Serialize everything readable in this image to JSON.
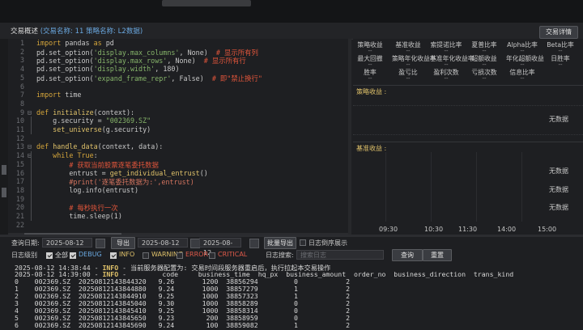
{
  "header": {
    "title": "交易概述",
    "meta": "(交易名称: 11  策略名称: L2数据)",
    "detail_button": "交易详情"
  },
  "editor": {
    "lines": [
      {
        "n": "1",
        "fold": "",
        "tokens": [
          {
            "c": "kw",
            "t": "import"
          },
          {
            "c": "",
            "t": " pandas "
          },
          {
            "c": "kw",
            "t": "as"
          },
          {
            "c": "",
            "t": " pd"
          }
        ]
      },
      {
        "n": "2",
        "fold": "",
        "tokens": [
          {
            "c": "",
            "t": "pd.set_option("
          },
          {
            "c": "st",
            "t": "'display.max_columns'"
          },
          {
            "c": "",
            "t": ", None)  "
          },
          {
            "c": "cm",
            "t": "# 显示所有列"
          }
        ]
      },
      {
        "n": "3",
        "fold": "",
        "tokens": [
          {
            "c": "",
            "t": "pd.set_option("
          },
          {
            "c": "st",
            "t": "'display.max_rows'"
          },
          {
            "c": "",
            "t": ", None)  "
          },
          {
            "c": "cm",
            "t": "# 显示所有行"
          }
        ]
      },
      {
        "n": "4",
        "fold": "",
        "tokens": [
          {
            "c": "",
            "t": "pd.set_option("
          },
          {
            "c": "st",
            "t": "'display.width'"
          },
          {
            "c": "",
            "t": ", 180)"
          }
        ]
      },
      {
        "n": "5",
        "fold": "",
        "tokens": [
          {
            "c": "",
            "t": "pd.set_option("
          },
          {
            "c": "st",
            "t": "'expand_frame_repr'"
          },
          {
            "c": "",
            "t": ", False)  "
          },
          {
            "c": "cm",
            "t": "# 即\"禁止换行\""
          }
        ]
      },
      {
        "n": "6",
        "fold": "",
        "tokens": []
      },
      {
        "n": "7",
        "fold": "",
        "tokens": [
          {
            "c": "kw",
            "t": "import"
          },
          {
            "c": "",
            "t": " time"
          }
        ]
      },
      {
        "n": "8",
        "fold": "",
        "tokens": []
      },
      {
        "n": "9",
        "fold": "⊟",
        "tokens": [
          {
            "c": "kw",
            "t": "def"
          },
          {
            "c": "",
            "t": " "
          },
          {
            "c": "fn",
            "t": "initialize"
          },
          {
            "c": "",
            "t": "(context):"
          }
        ]
      },
      {
        "n": "10",
        "fold": "",
        "tokens": [
          {
            "c": "",
            "t": "    g.security = "
          },
          {
            "c": "st",
            "t": "\"002369.SZ\""
          }
        ]
      },
      {
        "n": "11",
        "fold": "",
        "tokens": [
          {
            "c": "",
            "t": "    "
          },
          {
            "c": "fn",
            "t": "set_universe"
          },
          {
            "c": "",
            "t": "(g.security)"
          }
        ]
      },
      {
        "n": "12",
        "fold": "",
        "tokens": []
      },
      {
        "n": "13",
        "fold": "⊟",
        "tokens": [
          {
            "c": "kw",
            "t": "def"
          },
          {
            "c": "",
            "t": " "
          },
          {
            "c": "fn",
            "t": "handle_data"
          },
          {
            "c": "",
            "t": "(context, data):"
          }
        ]
      },
      {
        "n": "14",
        "fold": "⊟",
        "tokens": [
          {
            "c": "",
            "t": "    "
          },
          {
            "c": "kw",
            "t": "while"
          },
          {
            "c": "",
            "t": " "
          },
          {
            "c": "kw",
            "t": "True"
          },
          {
            "c": "",
            "t": ":"
          }
        ]
      },
      {
        "n": "15",
        "fold": "",
        "tokens": [
          {
            "c": "",
            "t": "        "
          },
          {
            "c": "cm",
            "t": "# 获取当前股票逐笔委托数据"
          }
        ]
      },
      {
        "n": "16",
        "fold": "",
        "tokens": [
          {
            "c": "",
            "t": "        entrust = "
          },
          {
            "c": "fn",
            "t": "get_individual_entrust"
          },
          {
            "c": "",
            "t": "()"
          }
        ]
      },
      {
        "n": "17",
        "fold": "",
        "tokens": [
          {
            "c": "",
            "t": "        "
          },
          {
            "c": "cm2",
            "t": "#print('逐笔委托数据为:',entrust)"
          }
        ]
      },
      {
        "n": "18",
        "fold": "",
        "tokens": [
          {
            "c": "",
            "t": "        log.info(entrust)"
          }
        ]
      },
      {
        "n": "19",
        "fold": "",
        "tokens": []
      },
      {
        "n": "20",
        "fold": "",
        "tokens": [
          {
            "c": "",
            "t": "        "
          },
          {
            "c": "cm",
            "t": "# 每秒执行一次"
          }
        ]
      },
      {
        "n": "21",
        "fold": "",
        "tokens": [
          {
            "c": "",
            "t": "        time.sleep(1)"
          }
        ]
      },
      {
        "n": "22",
        "fold": "",
        "tokens": []
      }
    ]
  },
  "metrics": {
    "row1": [
      "策略收益",
      "基准收益",
      "索提诺比率",
      "夏普比率",
      "Alpha比率",
      "Beta比率"
    ],
    "row2": [
      "最大回撤",
      "策略年化收益率",
      "基准年化收益率",
      "超额收益",
      "年化超额收益",
      "日胜率"
    ],
    "row3": [
      "胜率",
      "盈亏比",
      "盈利次数",
      "亏损次数",
      "信息比率"
    ],
    "placeholder": "--"
  },
  "charts": {
    "strategy_label": "策略收益 :",
    "benchmark_label": "基准收益 :",
    "no_data": "无数据",
    "x_ticks": [
      "09:30",
      "10:30",
      "11:30",
      "14:00",
      "15:00"
    ]
  },
  "query": {
    "date_label": "查询日期:",
    "date1": "2025-08-12",
    "export_btn": "导出",
    "date2": "2025-08-12",
    "date3": "2025-08-12",
    "batch_export_btn": "批量导出",
    "reverse_label": "日志倒序展示",
    "level_label": "日志级别",
    "levels": [
      {
        "label": "全部",
        "checked": true,
        "color": "#d8d8d8"
      },
      {
        "label": "DEBUG",
        "checked": true,
        "color": "#6aa8e0"
      },
      {
        "label": "INFO",
        "checked": true,
        "color": "#e0c26a"
      },
      {
        "label": "WARNING",
        "checked": false,
        "color": "#e0c26a"
      },
      {
        "label": "ERROR",
        "checked": false,
        "color": "#e05a4a"
      },
      {
        "label": "CRITICAL",
        "checked": false,
        "color": "#e05a4a"
      }
    ],
    "search_label": "日志搜索:",
    "search_placeholder": "搜索日志",
    "query_btn": "查询",
    "reset_btn": "重置"
  },
  "log": {
    "line1": {
      "ts": "2025-08-12 14:38:44 - ",
      "lvl": "INFO",
      "msg": " - 当前服务器配置为: 交易时间段服务器重启后，执行拉起本交易操作"
    },
    "line2": {
      "ts": "2025-08-12 14:39:00 - ",
      "lvl": "INFO",
      "msg": " -         code     business_time  hq_px  business_amount  order_no  business_direction  trans_kind"
    },
    "rows": [
      "0    002369.SZ  20250812143844320   9.26       1200  38856294         0            2",
      "1    002369.SZ  20250812143844880   9.24       1000  38857279         1            2",
      "2    002369.SZ  20250812143844910   9.25       1000  38857323         1            2",
      "3    002369.SZ  20250812143845040   9.30       1000  38858289         0            2",
      "4    002369.SZ  20250812143845410   9.25       1000  38858314         0            2",
      "5    002369.SZ  20250812143845650   9.23        200  38858959         0            2",
      "6    002369.SZ  20250812143845690   9.24        100  38859082         1            2"
    ]
  }
}
